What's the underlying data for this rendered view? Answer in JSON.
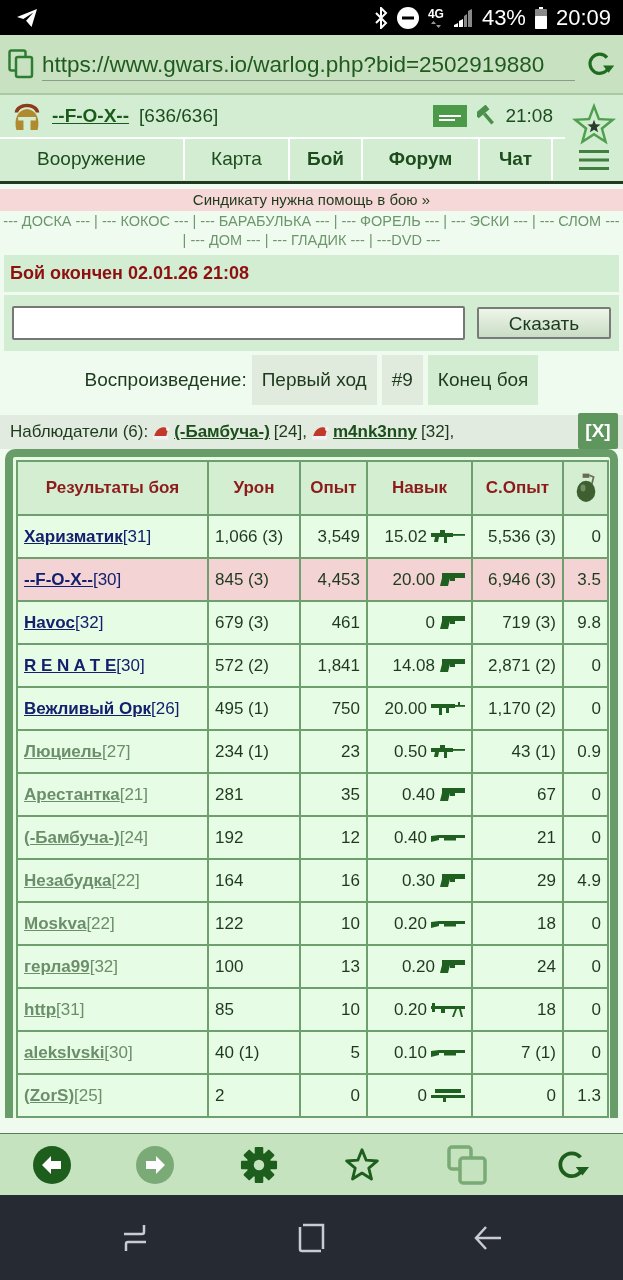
{
  "status_bar": {
    "network": "4G",
    "battery": "43%",
    "time": "20:09"
  },
  "browser": {
    "url": "https://www.gwars.io/warlog.php?bid=2502919880",
    "toolbar": [
      {
        "kind": "back",
        "disabled": false
      },
      {
        "kind": "forward",
        "disabled": true
      },
      {
        "kind": "settings",
        "disabled": false
      },
      {
        "kind": "bookmark",
        "disabled": false
      },
      {
        "kind": "tabs",
        "disabled": true
      },
      {
        "kind": "reload",
        "disabled": false
      }
    ]
  },
  "header": {
    "player": "--F-O-X--",
    "health": "[636/636]",
    "time": "21:08",
    "nav": [
      {
        "label": "Вооружение",
        "bold": false
      },
      {
        "label": "Карта",
        "bold": false
      },
      {
        "label": "Бой",
        "bold": true
      },
      {
        "label": "Форум",
        "bold": true
      },
      {
        "label": "Чат",
        "bold": true
      }
    ]
  },
  "banner": {
    "text": "Синдикату нужна помощь в бою »"
  },
  "clan_links": [
    {
      "label": "--- ДОСКА ---",
      "separator": "|"
    },
    {
      "label": "--- КОКОС ---",
      "separator": "|"
    },
    {
      "label": "--- БАРАБУЛЬКА ---",
      "separator": "|"
    },
    {
      "label": "--- ФОРЕЛЬ ---",
      "separator": "|"
    },
    {
      "label": "--- ЭСКИ ---",
      "separator": "|"
    },
    {
      "label": "--- СЛОМ ---",
      "separator": "|"
    },
    {
      "label": "--- ДОМ ---",
      "separator": "|"
    },
    {
      "label": "--- ГЛАДИК ---",
      "separator": "|"
    },
    {
      "label": "---DVD ---"
    }
  ],
  "battle_status": "Бой окончен 02.01.26 21:08",
  "chat": {
    "button": "Сказать"
  },
  "replay": {
    "label": "Воспроизведение:",
    "buttons": [
      {
        "label": "Первый ход",
        "selected": false
      },
      {
        "label": "#9",
        "selected": false
      },
      {
        "label": "Конец боя",
        "selected": true
      }
    ]
  },
  "observers": {
    "label": "Наблюдатели (6):",
    "people": [
      {
        "name": "(-Бамбуча-)",
        "rank": "[24],"
      },
      {
        "name": "m4nk3nny",
        "rank": "[32],"
      }
    ]
  },
  "results": {
    "close": "[X]",
    "columns": [
      "Результаты боя",
      "Урон",
      "Опыт",
      "Навык",
      "С.Опыт"
    ],
    "rows": [
      {
        "name": "Харизматик",
        "rank": "[31]",
        "color": "#14206e",
        "highlighted": false,
        "damage": "1,066 (3)",
        "exp": "3,549",
        "skill": "15.02",
        "weapon": {
          "kind": "rifle"
        },
        "total_exp": "5,536 (3)",
        "grenade": "0"
      },
      {
        "name": "--F-O-X--",
        "rank": "[30]",
        "color": "#14206e",
        "highlighted": true,
        "damage": "845 (3)",
        "exp": "4,453",
        "skill": "20.00",
        "weapon": {
          "kind": "pistol"
        },
        "total_exp": "6,946 (3)",
        "grenade": "3.5"
      },
      {
        "name": "Havoc",
        "rank": "[32]",
        "color": "#14206e",
        "highlighted": false,
        "damage": "679 (3)",
        "exp": "461",
        "skill": "0",
        "weapon": {
          "kind": "pistol"
        },
        "total_exp": "719 (3)",
        "grenade": "9.8"
      },
      {
        "name": "R E N A T E",
        "rank": "[30]",
        "color": "#14206e",
        "highlighted": false,
        "damage": "572 (2)",
        "exp": "1,841",
        "skill": "14.08",
        "weapon": {
          "kind": "pistol"
        },
        "total_exp": "2,871 (2)",
        "grenade": "0"
      },
      {
        "name": "Вежливый Орк",
        "rank": "[26]",
        "color": "#14206e",
        "highlighted": false,
        "damage": "495 (1)",
        "exp": "750",
        "skill": "20.00",
        "weapon": {
          "kind": "smg"
        },
        "total_exp": "1,170 (2)",
        "grenade": "0"
      },
      {
        "name": "Люциель",
        "rank": "[27]",
        "color": "#6b8e6b",
        "highlighted": false,
        "damage": "234 (1)",
        "exp": "23",
        "skill": "0.50",
        "weapon": {
          "kind": "rifle"
        },
        "total_exp": "43 (1)",
        "grenade": "0.9"
      },
      {
        "name": "Арестантка",
        "rank": "[21]",
        "color": "#6b8e6b",
        "highlighted": false,
        "damage": "281",
        "exp": "35",
        "skill": "0.40",
        "weapon": {
          "kind": "pistol"
        },
        "total_exp": "67",
        "grenade": "0"
      },
      {
        "name": "(-Бамбуча-)",
        "rank": "[24]",
        "color": "#6b8e6b",
        "highlighted": false,
        "damage": "192",
        "exp": "12",
        "skill": "0.40",
        "weapon": {
          "kind": "shotgun"
        },
        "total_exp": "21",
        "grenade": "0"
      },
      {
        "name": "Незабудка",
        "rank": "[22]",
        "color": "#6b8e6b",
        "highlighted": false,
        "damage": "164",
        "exp": "16",
        "skill": "0.30",
        "weapon": {
          "kind": "pistol"
        },
        "total_exp": "29",
        "grenade": "4.9"
      },
      {
        "name": "Moskva",
        "rank": "[22]",
        "color": "#6b8e6b",
        "highlighted": false,
        "damage": "122",
        "exp": "10",
        "skill": "0.20",
        "weapon": {
          "kind": "shotgun"
        },
        "total_exp": "18",
        "grenade": "0"
      },
      {
        "name": "герла99",
        "rank": "[32]",
        "color": "#6b8e6b",
        "highlighted": false,
        "damage": "100",
        "exp": "13",
        "skill": "0.20",
        "weapon": {
          "kind": "pistol"
        },
        "total_exp": "24",
        "grenade": "0"
      },
      {
        "name": "http",
        "rank": "[31]",
        "color": "#6b8e6b",
        "highlighted": false,
        "damage": "85",
        "exp": "10",
        "skill": "0.20",
        "weapon": {
          "kind": "machinegun"
        },
        "total_exp": "18",
        "grenade": "0"
      },
      {
        "name": "alekslvski",
        "rank": "[30]",
        "color": "#6b8e6b",
        "highlighted": false,
        "damage": "40 (1)",
        "exp": "5",
        "skill": "0.10",
        "weapon": {
          "kind": "shotgun"
        },
        "total_exp": "7 (1)",
        "grenade": "0"
      },
      {
        "name": "(ZorS)",
        "rank": "[25]",
        "color": "#6b8e6b",
        "highlighted": false,
        "damage": "2",
        "exp": "0",
        "skill": "0",
        "weapon": {
          "kind": "launcher"
        },
        "total_exp": "0",
        "grenade": "1.3"
      }
    ]
  }
}
